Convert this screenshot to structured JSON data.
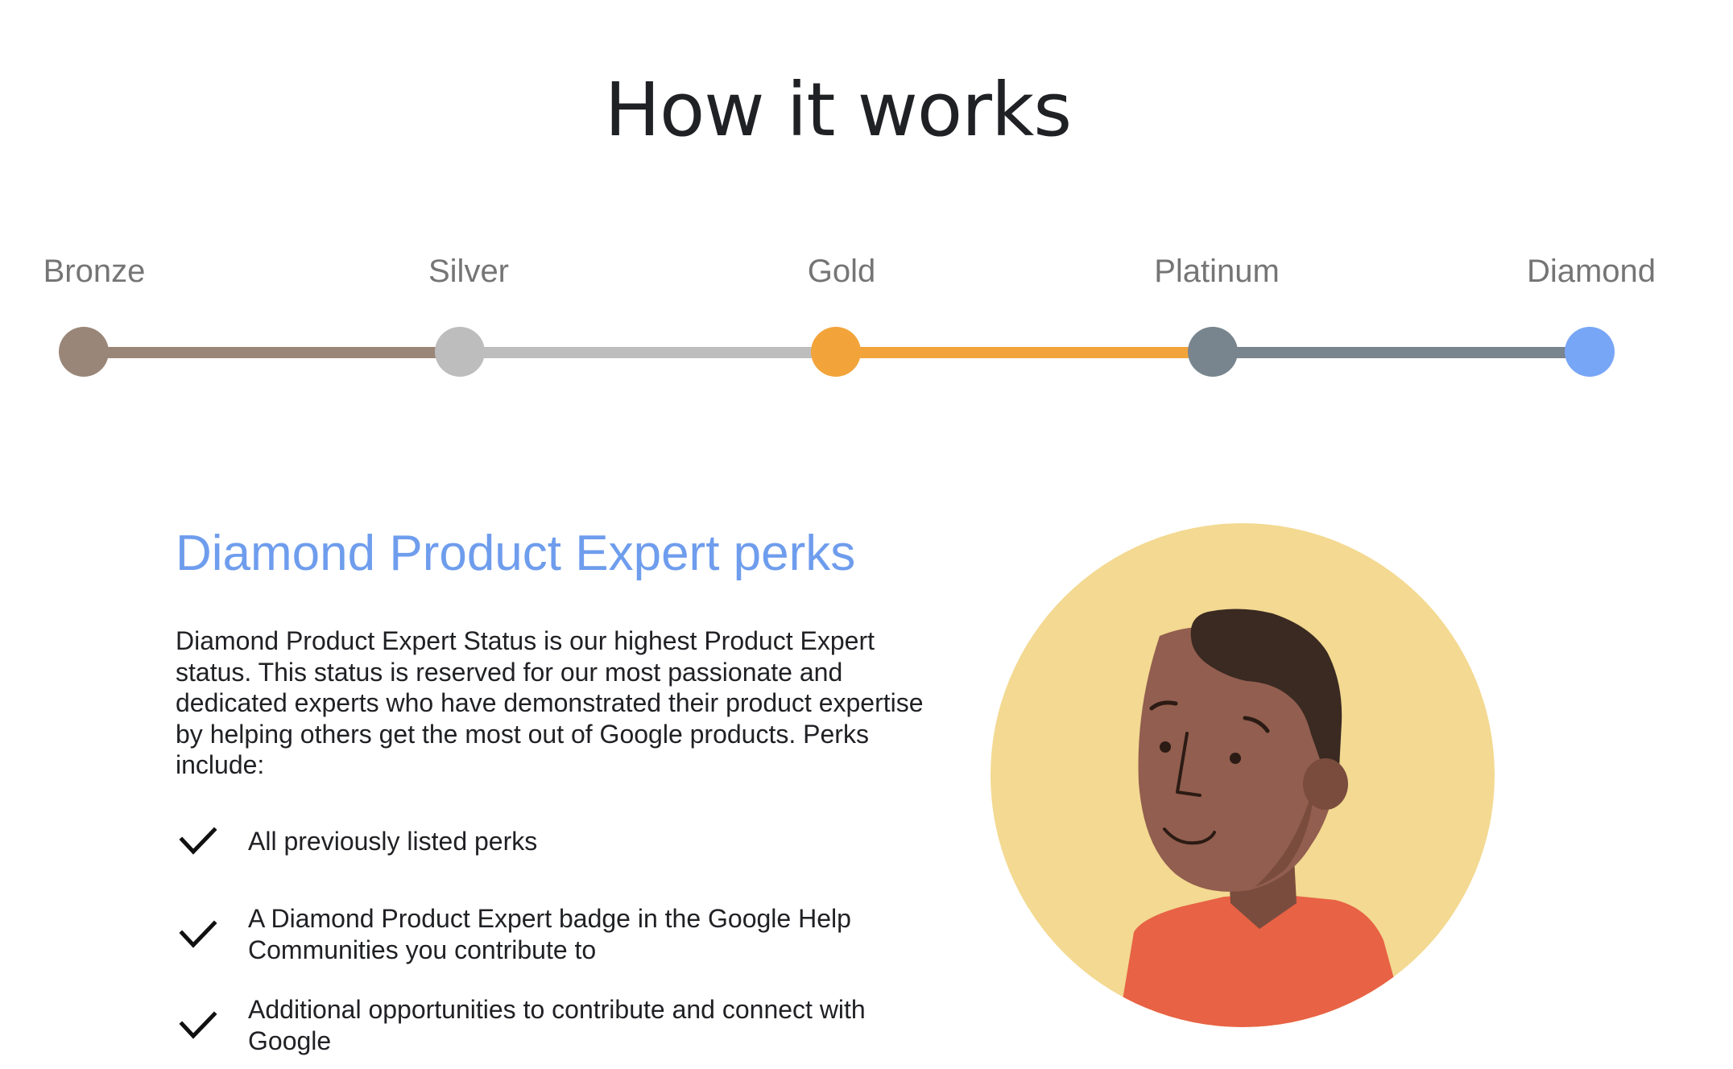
{
  "page": {
    "title": "How it works"
  },
  "tiers": [
    {
      "label": "Bronze",
      "color": "#9a8678"
    },
    {
      "label": "Silver",
      "color": "#bdbdbd"
    },
    {
      "label": "Gold",
      "color": "#f2a43b"
    },
    {
      "label": "Platinum",
      "color": "#78858e"
    },
    {
      "label": "Diamond",
      "color": "#78a6f6"
    }
  ],
  "perks_section": {
    "heading": "Diamond Product Expert perks",
    "intro": "Diamond Product Expert Status is our highest Product Expert status. This status is reserved for our most passionate and dedicated experts who have demonstrated their product expertise by helping others get the most out of Google products. Perks include:",
    "items": [
      {
        "text": "All previously listed perks",
        "icon": "checkmark-icon"
      },
      {
        "text": "A Diamond Product Expert badge in the Google Help Communities you contribute to",
        "icon": "checkmark-icon"
      },
      {
        "text": "Additional opportunities to contribute and connect with Google",
        "icon": "checkmark-icon"
      }
    ]
  },
  "illustration": {
    "subject": "expert-avatar",
    "colors": {
      "background": "#f3d991",
      "skin": "#925e4f",
      "skin_shadow": "#7a4c3e",
      "hair": "#3a2a22",
      "shirt": "#e86245"
    }
  },
  "colors": {
    "heading_accent": "#6f9ded",
    "body_text": "#202124",
    "tier_label": "#757575"
  }
}
